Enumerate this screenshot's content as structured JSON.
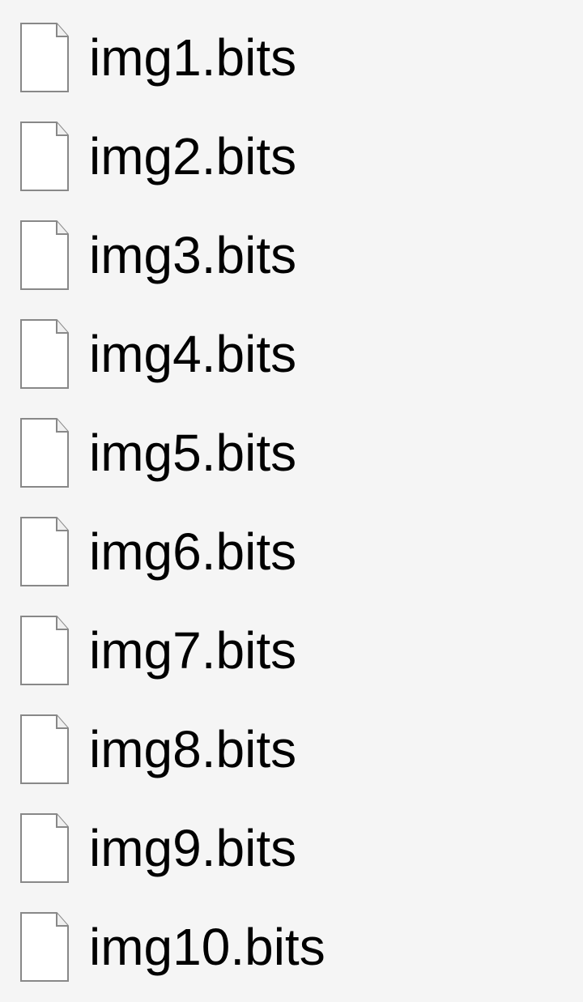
{
  "files": [
    {
      "name": "img1.bits"
    },
    {
      "name": "img2.bits"
    },
    {
      "name": "img3.bits"
    },
    {
      "name": "img4.bits"
    },
    {
      "name": "img5.bits"
    },
    {
      "name": "img6.bits"
    },
    {
      "name": "img7.bits"
    },
    {
      "name": "img8.bits"
    },
    {
      "name": "img9.bits"
    },
    {
      "name": "img10.bits"
    }
  ]
}
